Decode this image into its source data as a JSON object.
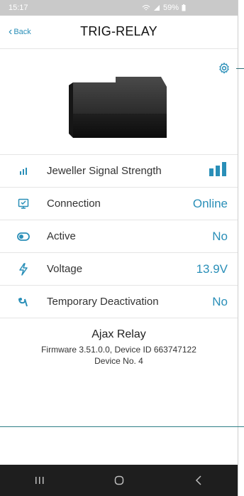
{
  "status": {
    "time": "15:17",
    "battery": "59%"
  },
  "nav": {
    "back_label": "Back",
    "title": "TRIG-RELAY"
  },
  "rows": [
    {
      "icon": "signal-icon",
      "label": "Jeweller Signal Strength",
      "value": ""
    },
    {
      "icon": "connection-icon",
      "label": "Connection",
      "value": "Online"
    },
    {
      "icon": "toggle-icon",
      "label": "Active",
      "value": "No"
    },
    {
      "icon": "voltage-icon",
      "label": "Voltage",
      "value": "13.9V"
    },
    {
      "icon": "deactivation-icon",
      "label": "Temporary Deactivation",
      "value": "No"
    }
  ],
  "device_info": {
    "name": "Ajax Relay",
    "firmware_line": "Firmware 3.51.0.0, Device ID 663747122",
    "device_no": "Device No. 4"
  },
  "signal_strength_bars": 3,
  "colors": {
    "accent": "#2a8fb8",
    "status_bar": "#c9c9c9",
    "nav_bar_bottom": "#1e1e1e"
  }
}
